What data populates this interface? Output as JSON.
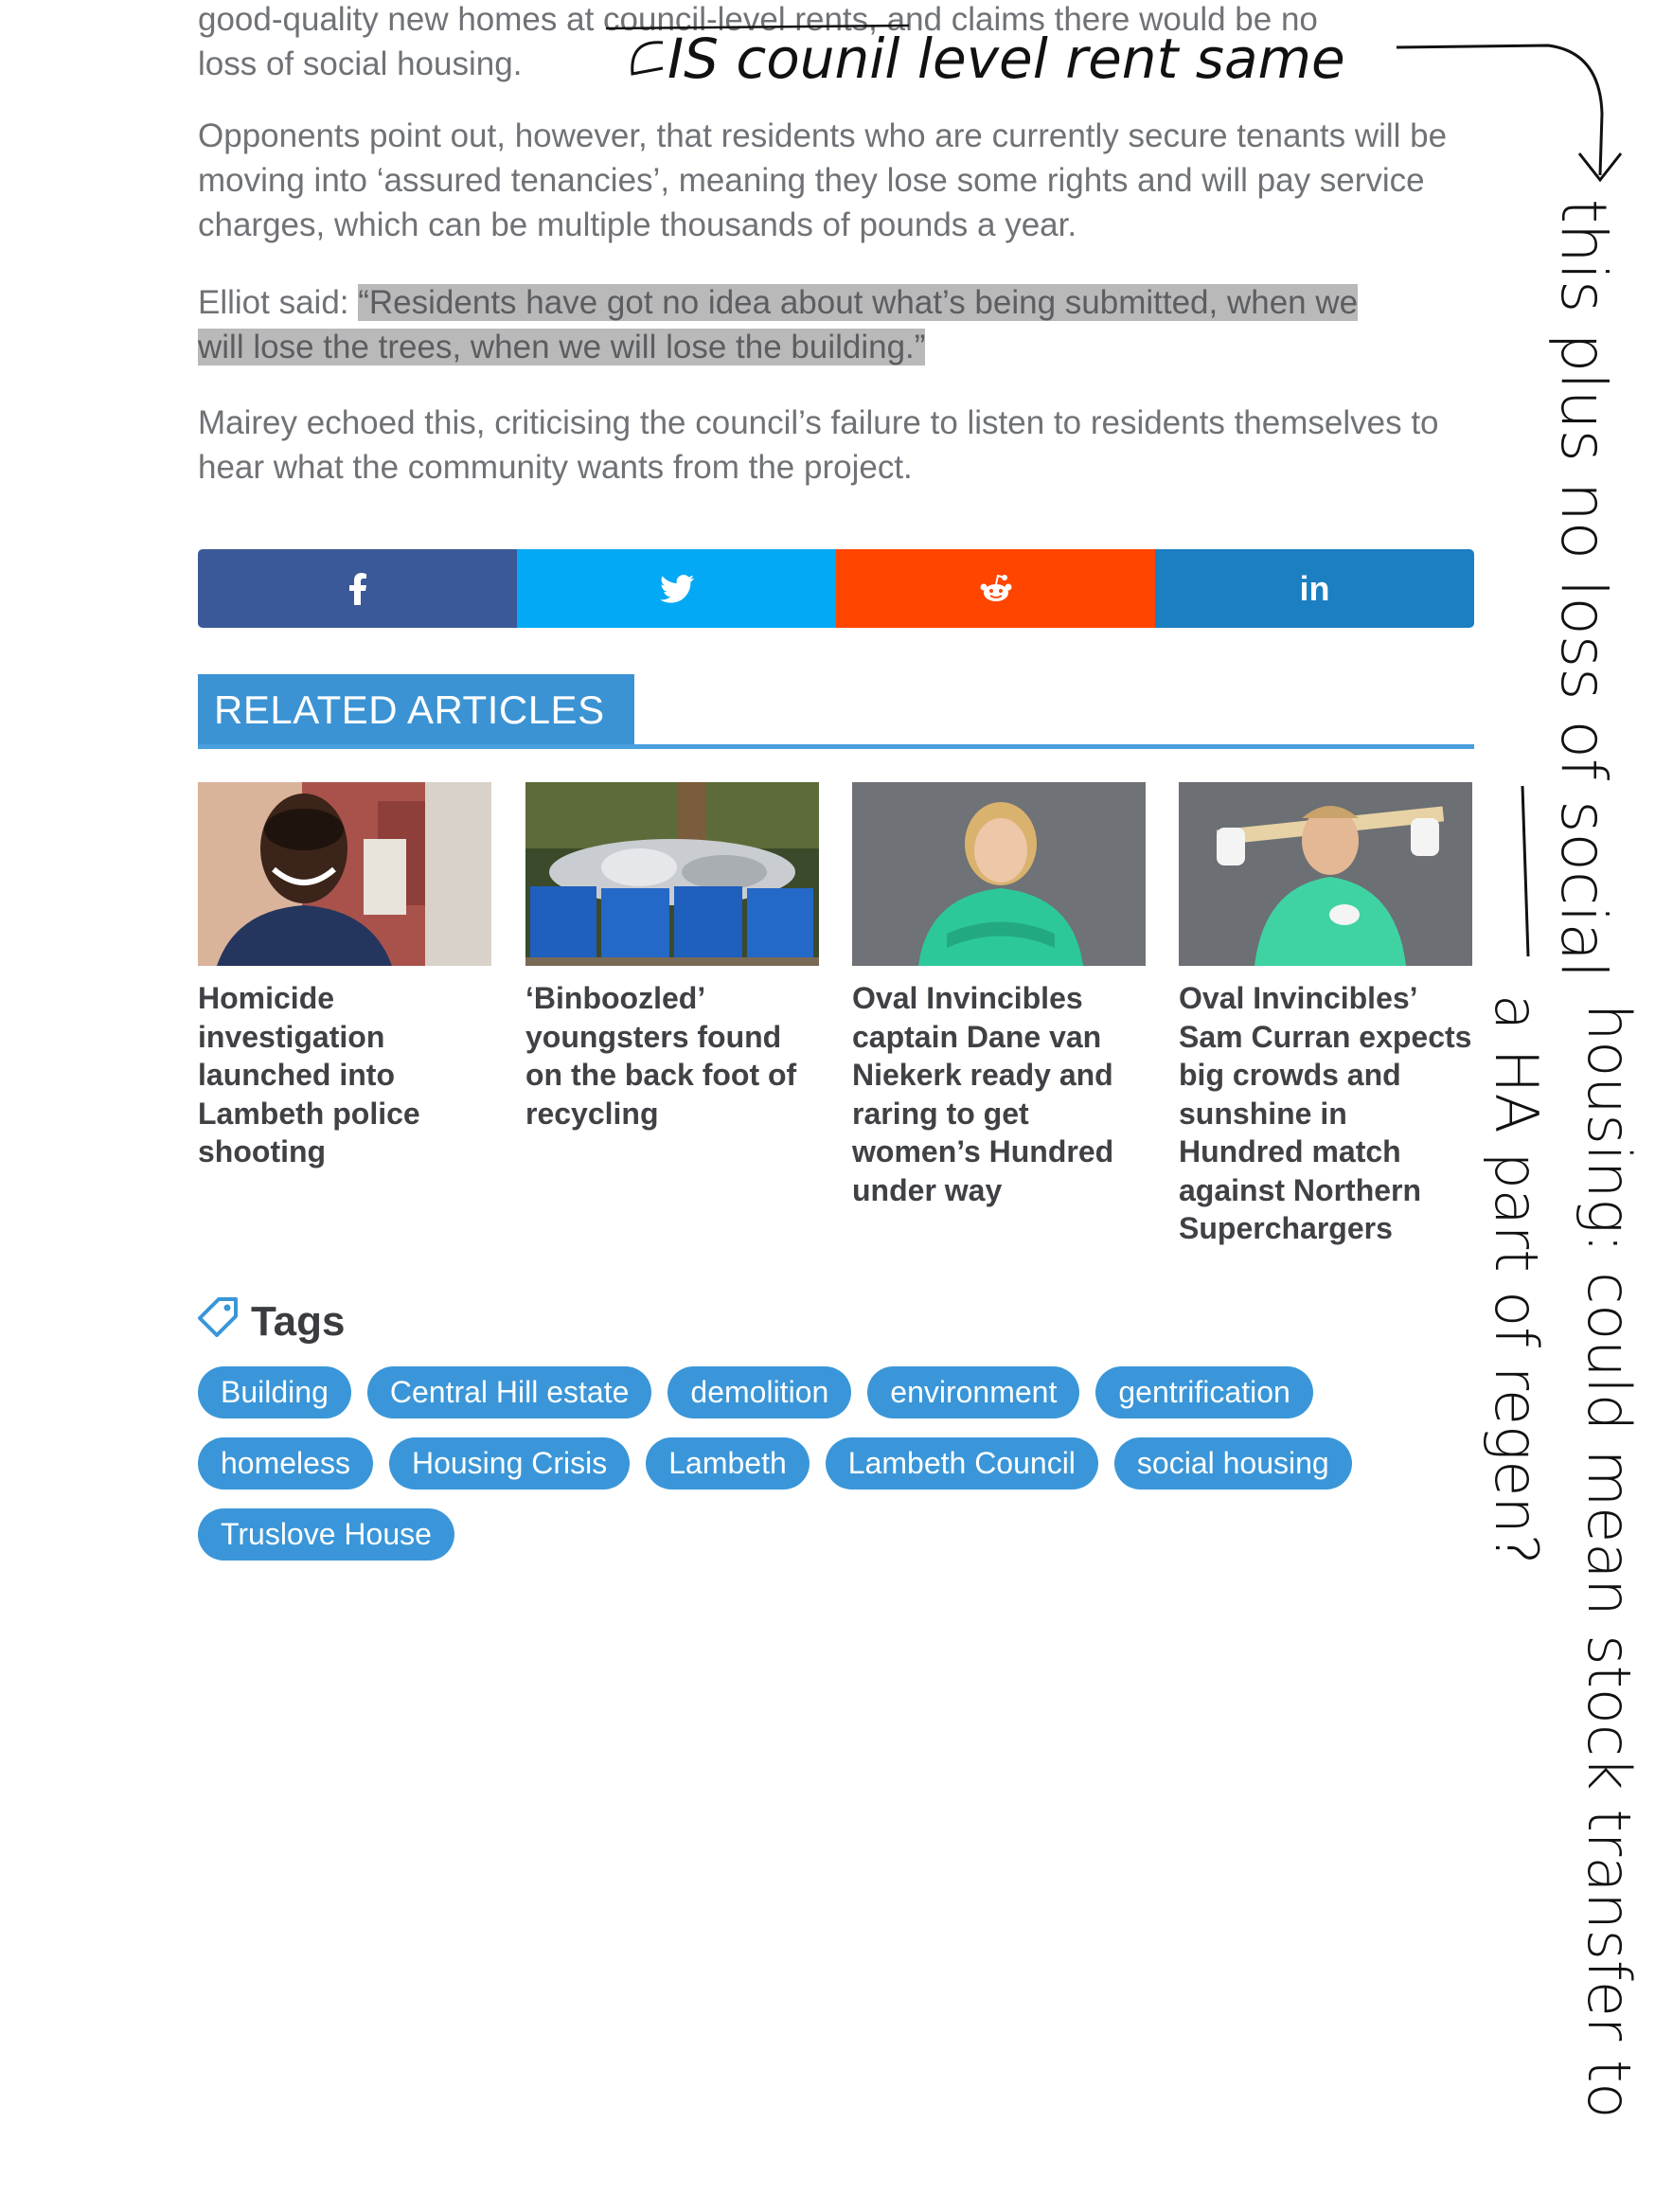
{
  "article": {
    "p1_line1": "good-quality new homes at council-level rents, and claims there would be no",
    "p1_line2": "loss of social housing.",
    "p2": "Opponents point out, however, that residents who are currently secure tenants will be moving into ‘assured tenancies’, meaning they lose some rights and will pay service charges, which can be multiple thousands of pounds a year.",
    "p3_lead": "Elliot said: ",
    "p3_quote_line1": "“Residents have got no idea about what’s being submitted, when we",
    "p3_quote_line2": "will lose the trees, when we will lose the building.”",
    "p4": "Mairey echoed this, criticising the council’s failure to listen to residents themselves to hear what the community wants from the project."
  },
  "share": {
    "facebook_icon": "facebook-icon",
    "twitter_icon": "twitter-icon",
    "reddit_icon": "reddit-icon",
    "linkedin_label": "in",
    "colors": {
      "facebook": "#3b5998",
      "twitter": "#03a9f4",
      "reddit": "#ff4500",
      "linkedin": "#1b7fc2"
    }
  },
  "related": {
    "heading": "RELATED ARTICLES",
    "articles": [
      {
        "title": "Homicide investigation launched into Lambeth police shooting",
        "image": "smiling man portrait"
      },
      {
        "title": "‘Binboozled’ youngsters found on the back foot of recycling",
        "image": "recycling boxes"
      },
      {
        "title": "Oval Invincibles captain Dane van Niekerk ready and raring to get women’s Hundred under way",
        "image": "cricketer in green kit"
      },
      {
        "title": "Oval Invincibles’ Sam Curran expects big crowds and sunshine in Hundred match against Northern Superchargers",
        "image": "cricketer holding bat"
      }
    ]
  },
  "tags": {
    "heading": "Tags",
    "rows": [
      [
        "Building",
        "Central Hill estate",
        "demolition",
        "environment",
        "gentrification"
      ],
      [
        "homeless",
        "Housing Crisis",
        "Lambeth",
        "Lambeth Council",
        "social housing"
      ],
      [
        "Truslove House"
      ]
    ],
    "color": "#3a96d8"
  },
  "annotations": {
    "note_top": "IS counil level rent same",
    "note_side_1": "this plus no loss of social",
    "note_side_2": "housing: could mean stock transfer to",
    "note_side_3": "a HA part of regen?"
  }
}
